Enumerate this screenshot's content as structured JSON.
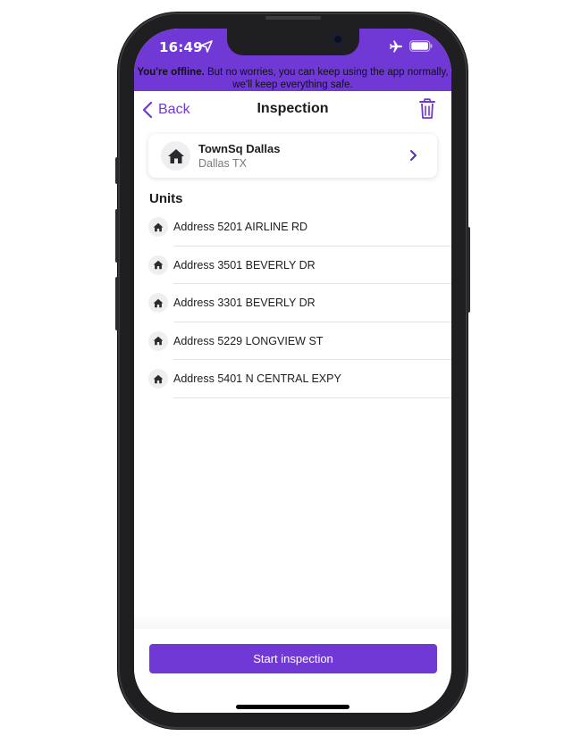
{
  "status_bar": {
    "time": "16:49",
    "icons": [
      "location-arrow-icon",
      "airplane-mode-icon",
      "battery-icon"
    ]
  },
  "offline_banner": {
    "bold_text": "You're offline.",
    "text": " But no worries, you can keep using the app normally, we'll keep everything safe."
  },
  "navbar": {
    "back_label": "Back",
    "title": "Inspection",
    "icons": [
      "chevron-left-icon",
      "trash-icon"
    ]
  },
  "community": {
    "name": "TownSq Dallas",
    "location": "Dallas TX",
    "icons": [
      "house-icon",
      "chevron-right-icon"
    ]
  },
  "units": {
    "heading": "Units",
    "items": [
      {
        "label": "Address 5201 AIRLINE RD"
      },
      {
        "label": "Address 3501 BEVERLY DR"
      },
      {
        "label": "Address 3301 BEVERLY DR"
      },
      {
        "label": "Address 5229 LONGVIEW ST"
      },
      {
        "label": "Address 5401 N CENTRAL EXPY"
      }
    ]
  },
  "footer": {
    "start_label": "Start inspection"
  },
  "colors": {
    "accent": "#7039d6",
    "text_primary": "#1e1e1e",
    "text_secondary": "#7a7a7a"
  }
}
